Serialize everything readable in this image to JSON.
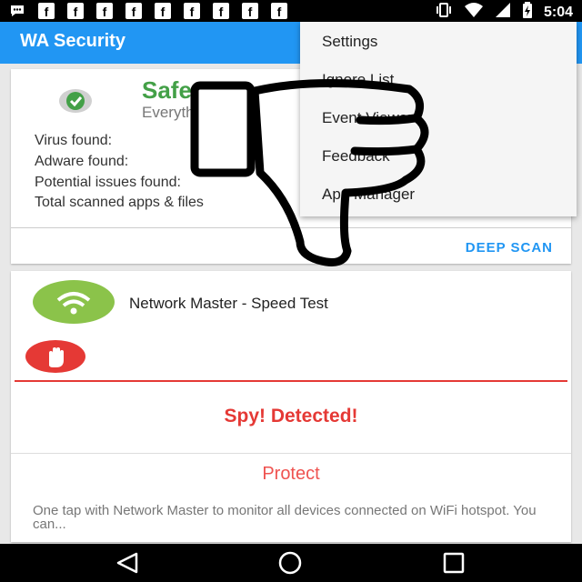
{
  "status_bar": {
    "time": "5:04",
    "left_icons": [
      "messages-icon",
      "facebook-icon",
      "facebook-icon",
      "facebook-icon",
      "facebook-icon",
      "facebook-icon",
      "facebook-icon",
      "facebook-icon",
      "facebook-icon",
      "facebook-icon"
    ],
    "fb_glyph": "f",
    "right_icons": [
      "vibrate-icon",
      "wifi-icon",
      "cell-signal-icon",
      "battery-icon"
    ]
  },
  "app_bar": {
    "title": "WA Security"
  },
  "scan_card": {
    "status_title": "Safe",
    "status_subtitle": "Everything is OK",
    "stats": [
      {
        "label": "Virus found:"
      },
      {
        "label": "Adware found:"
      },
      {
        "label": "Potential issues found:"
      },
      {
        "label": "Total scanned apps & files"
      }
    ],
    "deep_scan_label": "DEEP SCAN"
  },
  "threat_card": {
    "app_name": "Network Master - Speed Test",
    "alert": "Spy! Detected!",
    "protect_label": "Protect",
    "description": "One tap with Network Master to monitor all devices connected on WiFi hotspot. You can..."
  },
  "overflow_menu": {
    "items": [
      "Settings",
      "Ignore List",
      "Event Viewer",
      "Feedback",
      "App Manager"
    ]
  },
  "nav_bar": {
    "icons": [
      "back-icon",
      "home-icon",
      "recent-apps-icon"
    ]
  },
  "colors": {
    "primary": "#2196f3",
    "safe_green": "#43a047",
    "alert_red": "#e53935",
    "wifi_logo_green": "#8bc34a"
  }
}
